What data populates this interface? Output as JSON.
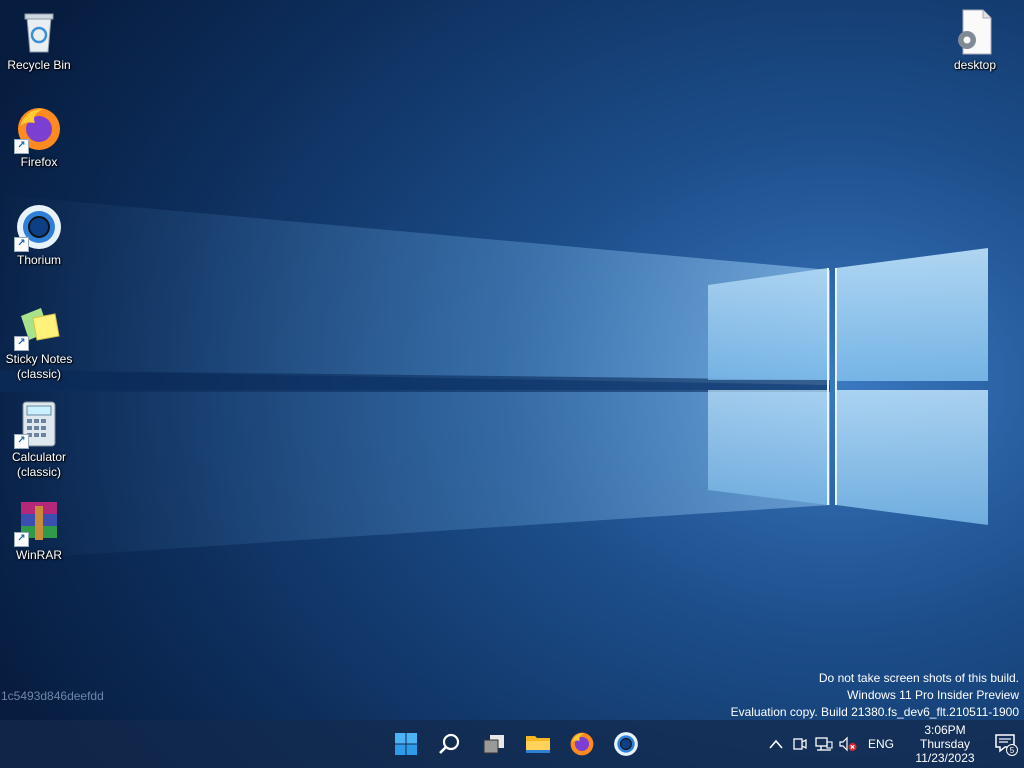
{
  "desktop": {
    "icons": [
      {
        "label": "Recycle Bin",
        "icon": "recycle-bin-icon"
      },
      {
        "label": "Firefox",
        "icon": "firefox-icon"
      },
      {
        "label": "Thorium",
        "icon": "thorium-icon"
      },
      {
        "label": "Sticky Notes\n(classic)",
        "icon": "sticky-notes-icon"
      },
      {
        "label": "Calculator\n(classic)",
        "icon": "calculator-icon"
      },
      {
        "label": "WinRAR",
        "icon": "winrar-icon"
      },
      {
        "label": "desktop",
        "icon": "settings-file-icon"
      }
    ]
  },
  "hash_tag": "1c5493d846deefdd",
  "watermark": {
    "line1": "Do not take screen shots of this build.",
    "line2": "Windows 11 Pro Insider Preview",
    "line3": "Evaluation copy. Build 21380.fs_dev6_flt.210511-1900"
  },
  "taskbar": {
    "apps": [
      "start-icon",
      "search-icon",
      "task-view-icon",
      "file-explorer-icon",
      "firefox-icon",
      "thorium-icon"
    ],
    "tray": {
      "language": "ENG",
      "time": "3:06PM",
      "day": "Thursday",
      "date": "11/23/2023",
      "notification_count": "5"
    }
  },
  "colors": {
    "wallpaper_dark": "#0b2a56",
    "wallpaper_light": "#5aa0d8",
    "taskbar": "#142a4c",
    "accent": "#0078d4"
  }
}
